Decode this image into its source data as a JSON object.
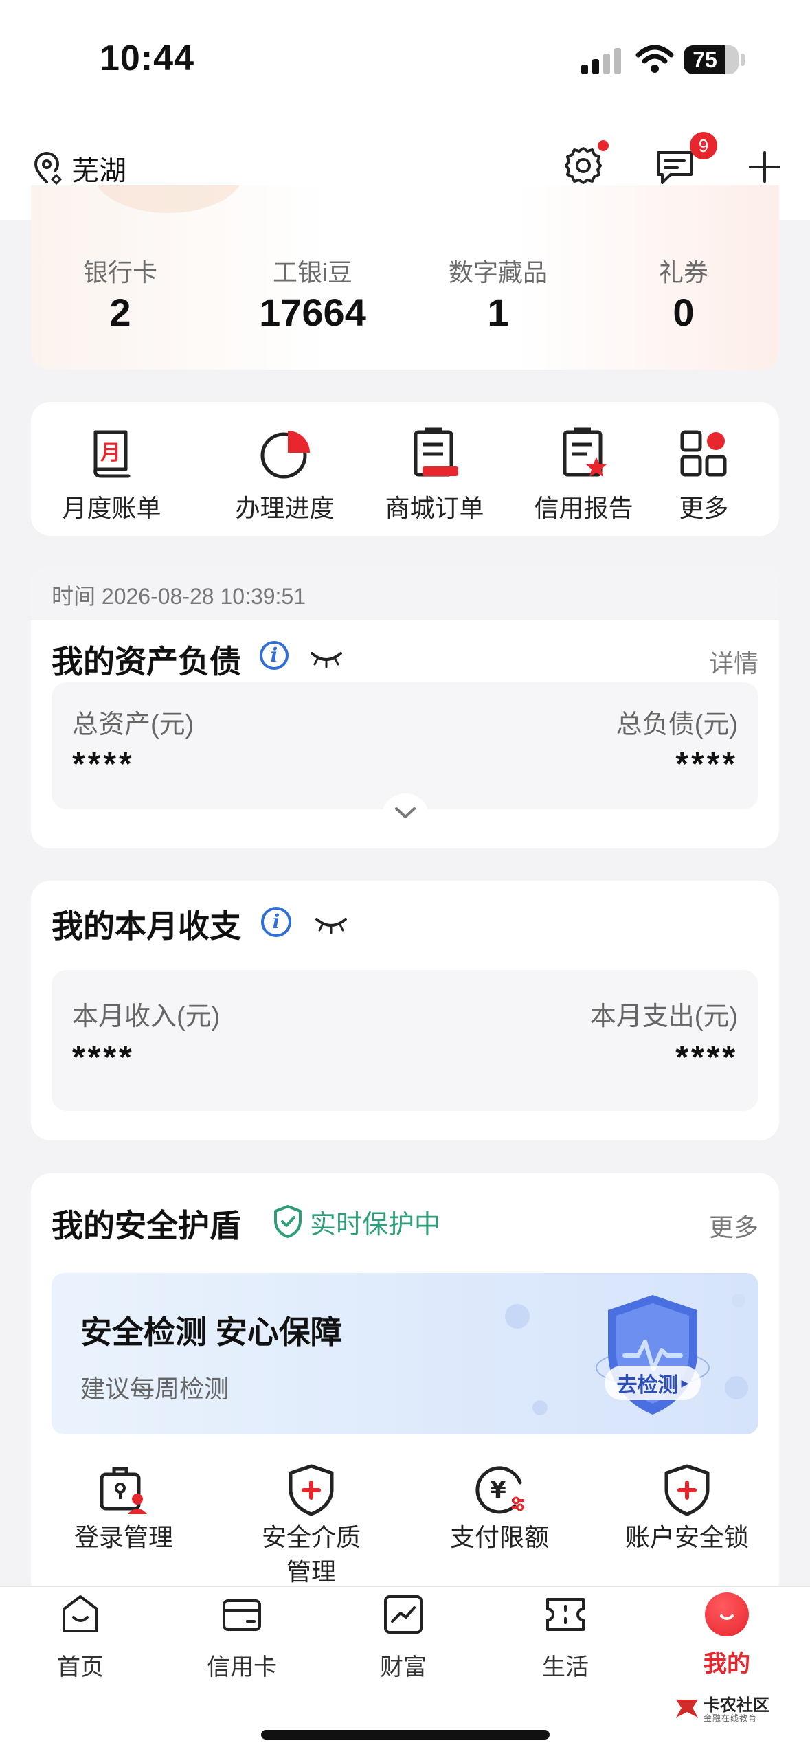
{
  "status_bar": {
    "time": "10:44",
    "battery": "75",
    "battery_level": 0.75
  },
  "header": {
    "location": "芜湖",
    "message_count": "9"
  },
  "stats": [
    {
      "label": "银行卡",
      "value": "2"
    },
    {
      "label": "工银i豆",
      "value": "17664"
    },
    {
      "label": "数字藏品",
      "value": "1"
    },
    {
      "label": "礼券",
      "value": "0"
    }
  ],
  "quick_actions": [
    {
      "label": "月度账单",
      "icon": "monthly-bill-icon",
      "glyph": "月"
    },
    {
      "label": "办理进度",
      "icon": "progress-icon"
    },
    {
      "label": "商城订单",
      "icon": "mall-order-icon"
    },
    {
      "label": "信用报告",
      "icon": "credit-report-icon"
    },
    {
      "label": "更多",
      "icon": "more-grid-icon"
    }
  ],
  "assets": {
    "timestamp": "时间 2026-08-28 10:39:51",
    "title": "我的资产负债",
    "detail": "详情",
    "total_assets_label": "总资产(元)",
    "total_assets_value": "****",
    "total_liabilities_label": "总负债(元)",
    "total_liabilities_value": "****"
  },
  "monthly": {
    "title": "我的本月收支",
    "income_label": "本月收入(元)",
    "income_value": "****",
    "expense_label": "本月支出(元)",
    "expense_value": "****"
  },
  "security": {
    "title": "我的安全护盾",
    "status": "实时保护中",
    "more": "更多",
    "banner_title": "安全检测 安心保障",
    "banner_subtitle": "建议每周检测",
    "banner_button": "去检测",
    "items": [
      {
        "label": "登录管理",
        "icon": "login-management-icon"
      },
      {
        "label": "安全介质管理",
        "icon": "security-medium-icon"
      },
      {
        "label": "支付限额",
        "icon": "payment-limit-icon",
        "glyph": "¥"
      },
      {
        "label": "账户安全锁",
        "icon": "account-lock-icon"
      }
    ]
  },
  "tabbar": [
    {
      "label": "首页",
      "icon": "home-icon"
    },
    {
      "label": "信用卡",
      "icon": "credit-card-icon"
    },
    {
      "label": "财富",
      "icon": "wealth-icon"
    },
    {
      "label": "生活",
      "icon": "life-ticket-icon"
    },
    {
      "label": "我的",
      "icon": "mine-icon",
      "active": true
    }
  ],
  "watermark": {
    "name": "卡农社区",
    "tagline": "金融在线教育"
  },
  "colors": {
    "brand_red": "#e8262e",
    "info_blue": "#2f6fd6",
    "shield_green": "#2e9d7a",
    "page_bg": "#f3f3f6"
  }
}
